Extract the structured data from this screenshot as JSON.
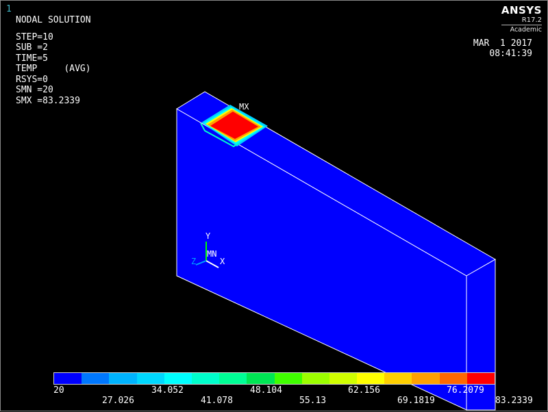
{
  "window_number": "1",
  "info": {
    "title": "NODAL SOLUTION",
    "step": "STEP=10",
    "sub": "SUB =2",
    "time": "TIME=5",
    "temp": "TEMP     (AVG)",
    "rsys": "RSYS=0",
    "smn": "SMN =20",
    "smx": "SMX =83.2339"
  },
  "logo": {
    "brand": "ANSYS",
    "version": "R17.2",
    "edition": "Academic"
  },
  "datetime": {
    "date": "MAR  1 2017",
    "time": "08:41:39"
  },
  "labels": {
    "max_marker": "MX",
    "min_marker": "MN",
    "axis_x": "X",
    "axis_y": "Y",
    "axis_z": "Z"
  },
  "colors": {
    "model_face": "#0000ff",
    "edges": "#ffffff",
    "hot": "#ff0000",
    "legend": [
      "#0000ff",
      "#0078ff",
      "#00b4ff",
      "#00d8ff",
      "#00ffff",
      "#00ffcc",
      "#00ff96",
      "#00e654",
      "#40ff00",
      "#9cff00",
      "#d0ff00",
      "#ffff00",
      "#ffd000",
      "#ffa000",
      "#ff6800",
      "#ff0000"
    ]
  },
  "legend_ticks": {
    "top": [
      "20",
      "34.052",
      "48.104",
      "62.156",
      "76.2079"
    ],
    "bottom": [
      "27.026",
      "41.078",
      "55.13",
      "69.1819",
      "83.2339"
    ]
  }
}
